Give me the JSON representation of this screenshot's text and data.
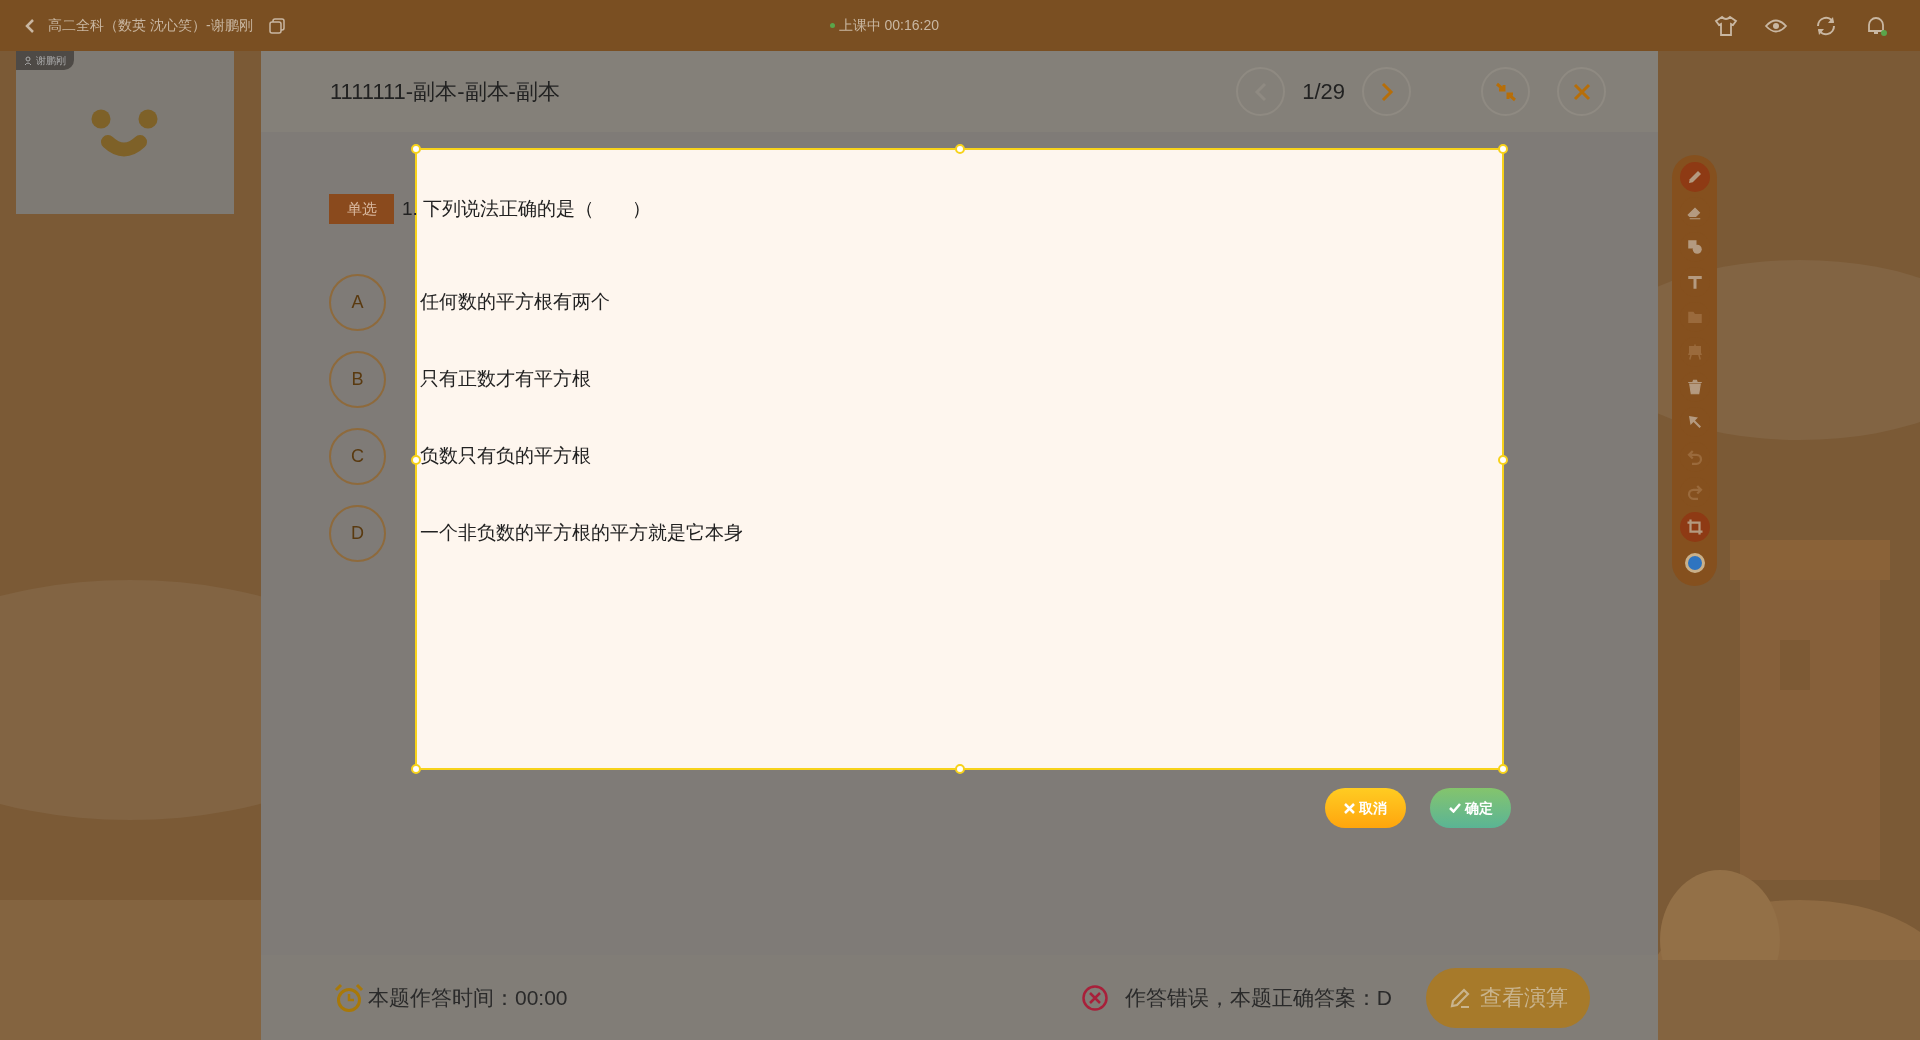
{
  "top_bar": {
    "class_title": "高二全科（数英 沈心笑）-谢鹏刚",
    "status": "上课中 00:16:20"
  },
  "video": {
    "name": "谢鹏刚"
  },
  "quiz": {
    "title": "1111111-副本-副本-副本",
    "page": "1/29",
    "question_type": "单选",
    "question": "1. 下列说法正确的是（　　）",
    "options": [
      {
        "letter": "A",
        "text": "任何数的平方根有两个",
        "selected": false
      },
      {
        "letter": "B",
        "text": "只有正数才有平方根",
        "selected": false
      },
      {
        "letter": "C",
        "text": "负数只有负的平方根",
        "selected": false
      },
      {
        "letter": "D",
        "text": "一个非负数的平方根的平方就是它本身",
        "selected": false
      }
    ],
    "crop_buttons": [
      "取消",
      "确定"
    ],
    "answer_time": "本题作答时间：00:00",
    "result": "作答错误，本题正确答案：D",
    "calc_button": "查看演算"
  },
  "toolbar": [
    {
      "kind": "pencil",
      "selected": true,
      "disabled": false
    },
    {
      "kind": "eraser",
      "selected": false,
      "disabled": false
    },
    {
      "kind": "shapes",
      "selected": false,
      "disabled": false
    },
    {
      "kind": "text",
      "selected": false,
      "disabled": false
    },
    {
      "kind": "folder",
      "selected": false,
      "disabled": true
    },
    {
      "kind": "easel",
      "selected": false,
      "disabled": true
    },
    {
      "kind": "trash",
      "selected": false,
      "disabled": false
    },
    {
      "kind": "pointer",
      "selected": false,
      "disabled": false
    },
    {
      "kind": "undo",
      "selected": false,
      "disabled": true
    },
    {
      "kind": "redo",
      "selected": false,
      "disabled": true
    },
    {
      "kind": "crop",
      "selected": true,
      "disabled": false
    },
    {
      "kind": "color",
      "color": "#2e74c0"
    }
  ]
}
